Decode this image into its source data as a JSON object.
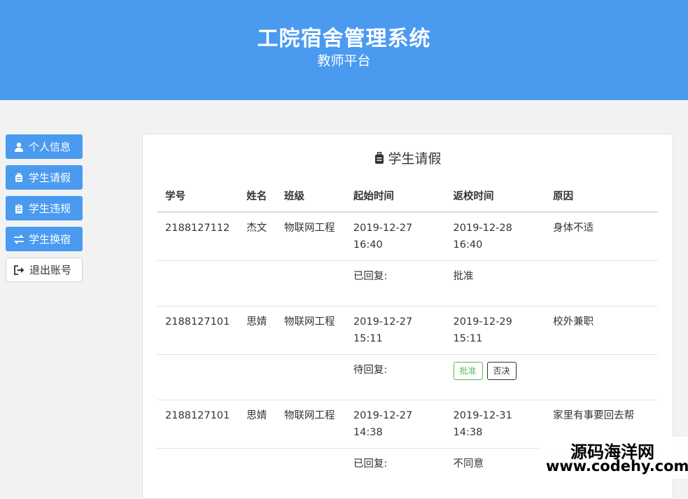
{
  "header": {
    "title": "工院宿舍管理系统",
    "subtitle": "教师平台"
  },
  "sidebar": {
    "items": [
      {
        "label": "个人信息",
        "icon": "user-icon"
      },
      {
        "label": "学生请假",
        "icon": "suitcase-icon"
      },
      {
        "label": "学生违规",
        "icon": "clipboard-icon"
      },
      {
        "label": "学生换宿",
        "icon": "exchange-icon"
      },
      {
        "label": "退出账号",
        "icon": "sign-out-icon"
      }
    ]
  },
  "panel": {
    "title": "学生请假",
    "columns": [
      "学号",
      "姓名",
      "班级",
      "起始时间",
      "返校时间",
      "原因"
    ],
    "rows": [
      {
        "id": "2188127112",
        "name": "杰文",
        "class": "物联网工程",
        "start": "2019-12-27 16:40",
        "return": "2019-12-28 16:40",
        "reason": "身体不适",
        "status_label": "已回复:",
        "status_value": "批准"
      },
      {
        "id": "2188127101",
        "name": "思婧",
        "class": "物联网工程",
        "start": "2019-12-27 15:11",
        "return": "2019-12-29 15:11",
        "reason": "校外兼职",
        "status_label": "待回复:",
        "approve_label": "批准",
        "deny_label": "否决"
      },
      {
        "id": "2188127101",
        "name": "思婧",
        "class": "物联网工程",
        "start": "2019-12-27 14:38",
        "return": "2019-12-31 14:38",
        "reason": "家里有事要回去帮",
        "status_label": "已回复:",
        "status_value": "不同意"
      }
    ]
  },
  "watermark": {
    "line1": "源码海洋网",
    "line2": "www.codehy.com"
  }
}
